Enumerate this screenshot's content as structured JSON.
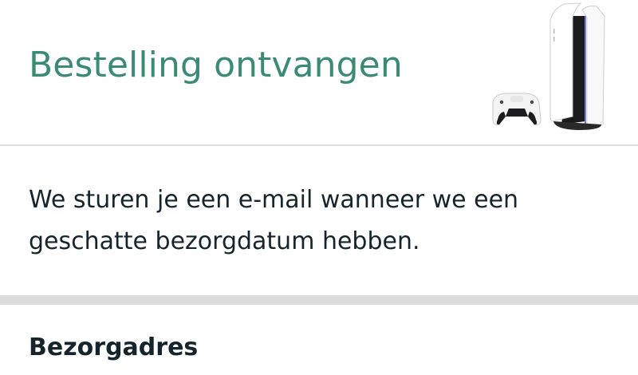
{
  "header": {
    "title": "Bestelling ontvangen",
    "product_image": "playstation-5-console-and-controller"
  },
  "message": {
    "text": "We sturen je een e-mail wanneer we een geschatte bezorgdatum hebben."
  },
  "delivery_section": {
    "title": "Bezorgadres"
  },
  "colors": {
    "title_green": "#3b8a76",
    "text_dark": "#16242b",
    "divider_gray": "#dcdcdc"
  }
}
